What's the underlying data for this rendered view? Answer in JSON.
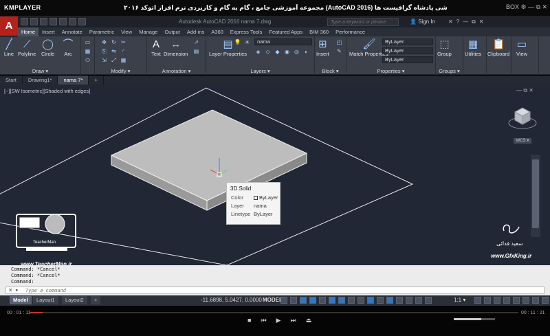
{
  "player": {
    "logo": "KMPLAYER",
    "course_title": "مجموعه آموزشی جامع ، گام به گام و کاربردی نرم افزار اتوکد ۲۰۱۶ (AutoCAD 2016) مدرس : سعید فدائی (تیچرمن) گروه آموزشی پادشاه گرافیست ها",
    "top_right": "BOX ⚙ — ⧉ ✕",
    "time_current": "00 : 01 : 11",
    "time_total": "00 : 11 : 21",
    "progress_fraction": 0.025,
    "volume_fraction": 0.67
  },
  "app": {
    "logo": "A",
    "document_title": "Autodesk AutoCAD 2016   nama 7.dwg",
    "search_placeholder": "Type a keyword or phrase",
    "signin_label": "Sign In",
    "accent": "#b5221c"
  },
  "ribbon_tabs": [
    "Home",
    "Insert",
    "Annotate",
    "Parametric",
    "View",
    "Manage",
    "Output",
    "Add-ins",
    "A360",
    "Express Tools",
    "Featured Apps",
    "BIM 360",
    "Performance"
  ],
  "active_tab": "Home",
  "ribbon": {
    "draw": {
      "label": "Draw ▾",
      "tools": [
        "Line",
        "Polyline",
        "Circle",
        "Arc"
      ]
    },
    "modify": {
      "label": "Modify ▾"
    },
    "annotation": {
      "label": "Annotation ▾",
      "tools": [
        "Text",
        "Dimension"
      ]
    },
    "layers": {
      "label": "Layers ▾",
      "tool": "Layer Properties",
      "current_layer": "nama"
    },
    "block": {
      "label": "Block ▾",
      "tool": "Insert"
    },
    "properties": {
      "label": "Properties ▾",
      "tool": "Match Properties",
      "color": "ByLayer",
      "linetype": "ByLayer",
      "lineweight": "ByLayer"
    },
    "groups": {
      "label": "Groups ▾",
      "tool": "Group"
    },
    "utilities": {
      "tool": "Utilities"
    },
    "clipboard": {
      "tool": "Clipboard"
    },
    "view": {
      "tool": "View"
    }
  },
  "file_tabs": [
    "Start",
    "Drawing1*",
    "nama 7*",
    "+"
  ],
  "active_file_tab": "nama 7*",
  "viewport": {
    "label": "[−][SW Isometric][Shaded with edges]",
    "controls": "— ⧉ ✕",
    "wcs": "WCS ▾"
  },
  "tooltip": {
    "title": "3D Solid",
    "rows": [
      {
        "key": "Color",
        "value": "ByLayer"
      },
      {
        "key": "Layer",
        "value": "nama"
      },
      {
        "key": "Linetype",
        "value": "ByLayer"
      }
    ]
  },
  "watermarks": {
    "teacher_brand": "TeacherMan",
    "teacher_url": "www.TeacherMan.ir",
    "gfx_name": "سعید فدائی",
    "gfx_url": "www.GfxKing.ir"
  },
  "command_line": {
    "history": [
      "Command: *Cancel*",
      "Command: *Cancel*",
      "Command:"
    ],
    "prompt": "▸",
    "close": "✕",
    "placeholder": "Type a command"
  },
  "layout_tabs": [
    "Model",
    "Layout1",
    "Layout2",
    "+"
  ],
  "active_layout": "Model",
  "status": {
    "coords": "-11.6898, 5.0427, 0.0000",
    "model": "MODEL",
    "scale": "1:1 ▾"
  }
}
